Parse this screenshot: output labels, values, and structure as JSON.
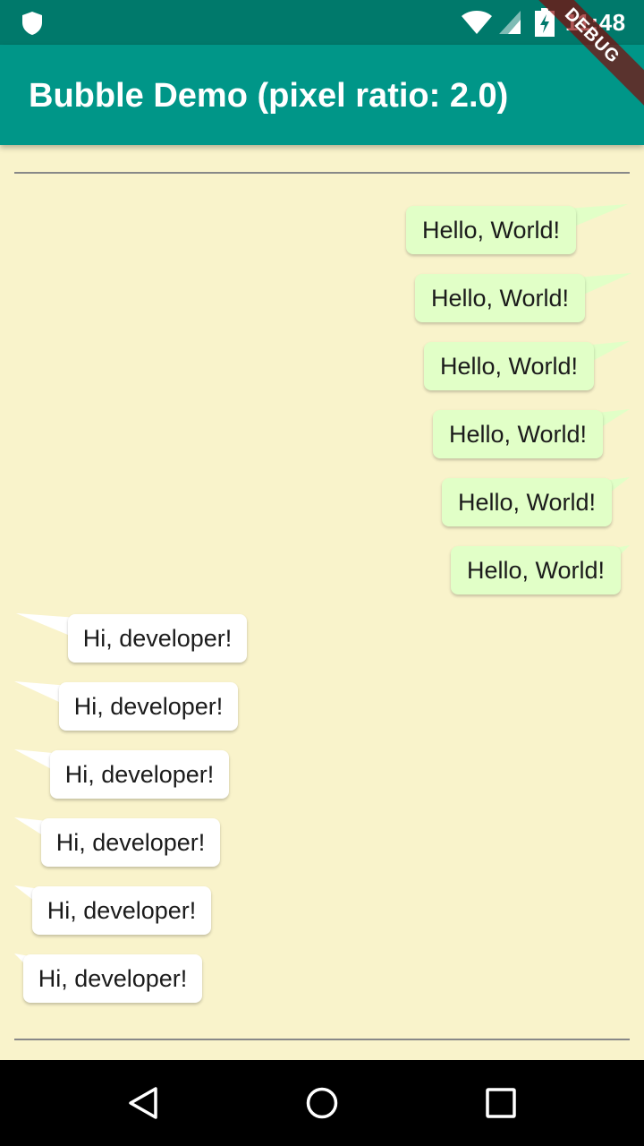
{
  "status_bar": {
    "time": "11:48"
  },
  "app_bar": {
    "title": "Bubble Demo (pixel ratio: 2.0)"
  },
  "debug_banner": "DEBUG",
  "messages_sent": [
    "Hello, World!",
    "Hello, World!",
    "Hello, World!",
    "Hello, World!",
    "Hello, World!",
    "Hello, World!"
  ],
  "messages_received": [
    "Hi, developer!",
    "Hi, developer!",
    "Hi, developer!",
    "Hi, developer!",
    "Hi, developer!",
    "Hi, developer!"
  ],
  "colors": {
    "background": "#f9f3cb",
    "app_bar": "#009688",
    "status_bar": "#00796b",
    "sent_bubble": "#e1ffc7",
    "received_bubble": "#ffffff"
  },
  "nav_bar": {
    "icons": [
      "back-icon",
      "home-icon",
      "recents-icon"
    ]
  }
}
